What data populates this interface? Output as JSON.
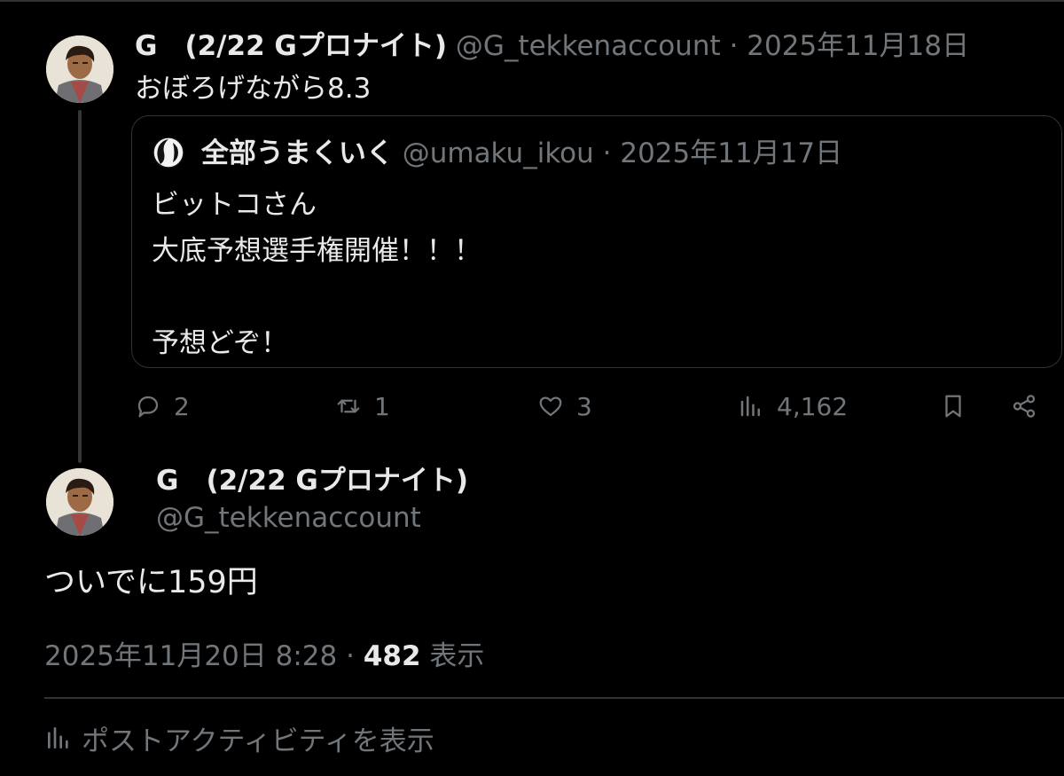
{
  "colors": {
    "background": "#000000",
    "primary_text": "#e7e9ea",
    "secondary_text": "#71767b",
    "border": "#2f3336"
  },
  "reply_tweet": {
    "display_name": "G　(2/22 Gプロナイト)",
    "handle": "@G_tekkenaccount",
    "separator": "·",
    "date": "2025年11月18日",
    "text": "おぼろげながら8.3",
    "quote": {
      "display_name": "全部うまくいく",
      "handle": "@umaku_ikou",
      "separator": "·",
      "date": "2025年11月17日",
      "lines": [
        "ビットコさん",
        "大底予想選手権開催！！！",
        "",
        "予想どぞ！"
      ]
    },
    "actions": {
      "reply_count": "2",
      "retweet_count": "1",
      "like_count": "3",
      "view_count": "4,162",
      "icons": [
        "reply-icon",
        "retweet-icon",
        "heart-icon",
        "views-icon",
        "bookmark-icon",
        "share-icon"
      ]
    }
  },
  "main_tweet": {
    "display_name": "G　(2/22 Gプロナイト)",
    "handle": "@G_tekkenaccount",
    "text": "ついでに159円",
    "timestamp": "2025年11月20日 8:28",
    "separator": "·",
    "views": "482",
    "views_label": "表示"
  },
  "post_activity": {
    "label": "ポストアクティビティを表示",
    "icon": "chart-icon"
  }
}
